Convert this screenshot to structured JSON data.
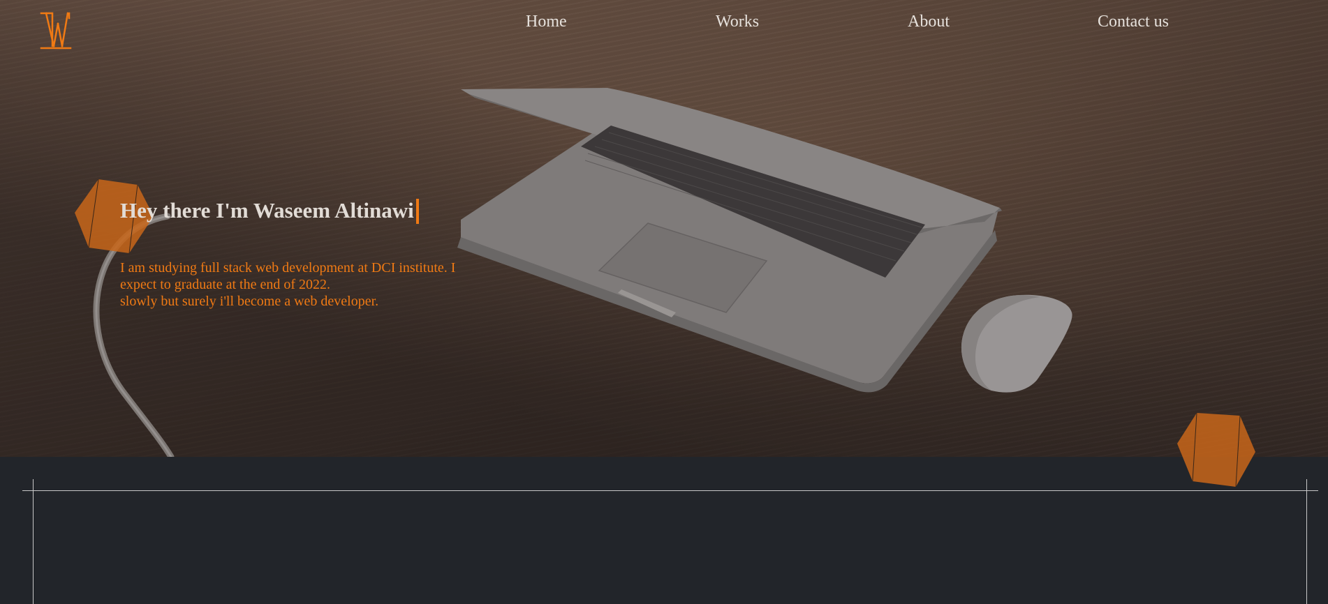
{
  "brand": {
    "logo_icon": "wa-monogram-logo",
    "accent_color": "#f07a14"
  },
  "nav": {
    "items": [
      {
        "label": "Home"
      },
      {
        "label": "Works"
      },
      {
        "label": "About"
      },
      {
        "label": "Contact us"
      }
    ]
  },
  "hero": {
    "background_image": "laptop-and-mouse-on-wooden-desk",
    "title": "Hey there I'm Waseem Altinawi",
    "lines": [
      "I am studying full stack web development at DCI institute. I",
      "expect to graduate at the end of 2022.",
      "slowly but surely i'll become a web developer."
    ]
  },
  "decorations": {
    "hexagon_color": "#c8661a"
  }
}
